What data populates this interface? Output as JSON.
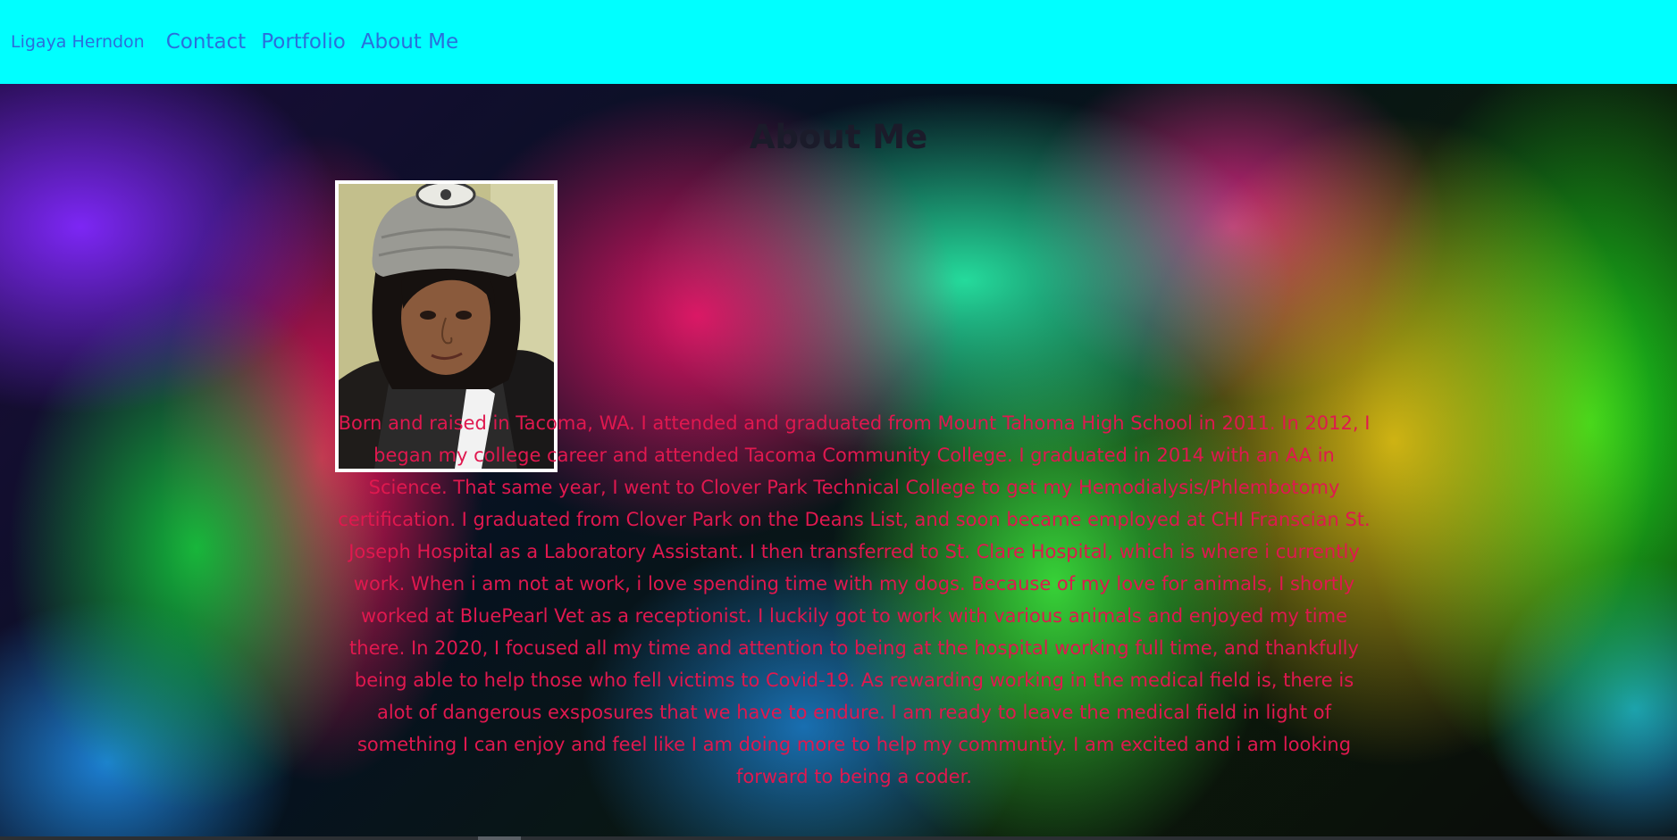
{
  "nav": {
    "brand": "Ligaya Herndon",
    "links": [
      "Contact",
      "Portfolio",
      "About Me"
    ]
  },
  "about": {
    "title": "About Me",
    "bio": "Born and raised in Tacoma, WA. I attended and graduated from Mount Tahoma High School in 2011. In 2012, I began my college career and attended Tacoma Community College. I graduated in 2014 with an AA in Science. That same year, I went to Clover Park Technical College to get my Hemodialysis/Phlembotomy certification. I graduated from Clover Park on the Deans List, and soon became employed at CHI Franscian St. Joseph Hospital as a Laboratory Assistant. I then transferred to St. Clare Hospital, which is where i currently work. When i am not at work, i love spending time with my dogs. Because of my love for animals, I shortly worked at BluePearl Vet as a receptionist. I luckily got to work with various animals and enjoyed my time there. In 2020, I focused all my time and attention to being at the hospital working full time, and thankfully being able to help those who fell victims to Covid-19. As rewarding working in the medical field is, there is alot of dangerous exsposures that we have to endure. I am ready to leave the medical field in light of something I can enjoy and feel like I am doing more to help my communtiy. I am excited and i am looking forward to being a coder."
  },
  "colors": {
    "navbar_bg": "#00ffff",
    "nav_link": "#2a6fdb",
    "title": "#1b1b2a",
    "bio_text": "#e0184f"
  }
}
